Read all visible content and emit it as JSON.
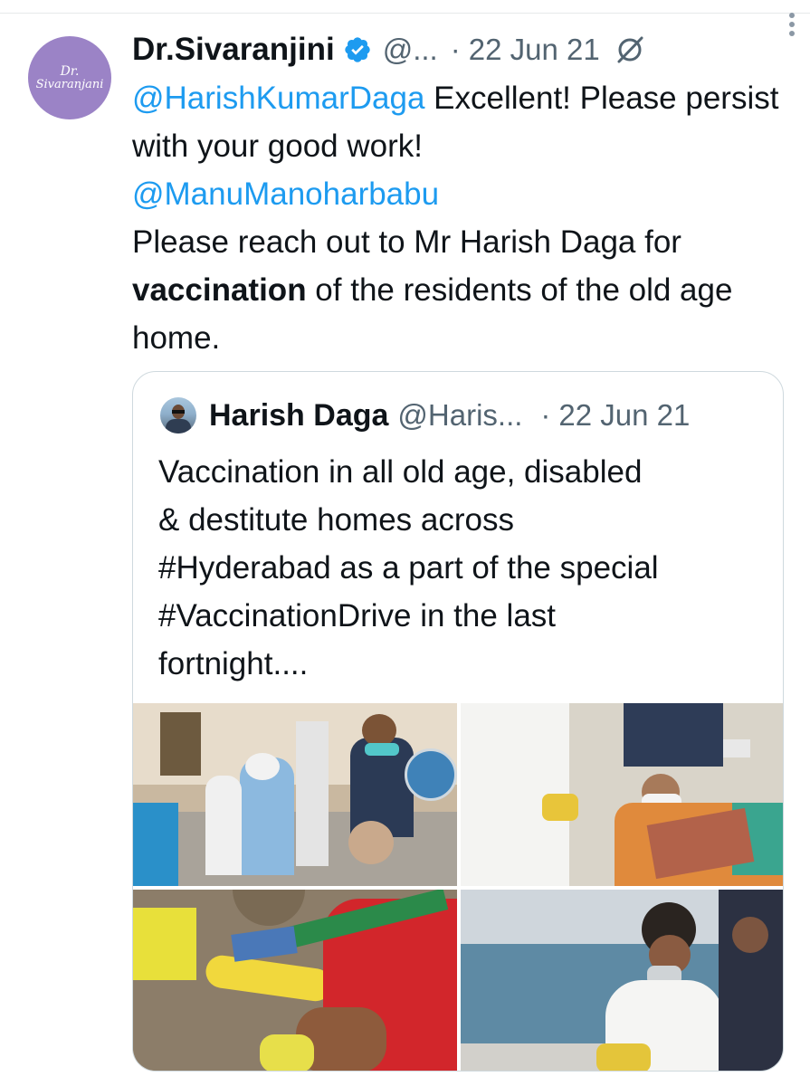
{
  "tweet": {
    "author_name": "Dr.Sivaranjini",
    "avatar_text_line1": "Dr.",
    "avatar_text_line2": "Sivaranjani",
    "handle": "@...",
    "separator": "·",
    "date": "22 Jun 21",
    "text": {
      "mention1": "@HarishKumarDaga",
      "part1": " Excellent! Please persist with your good work!",
      "mention2": "@ManuManoharbabu",
      "part2": "Please reach out to Mr Harish Daga for ",
      "bold": "vaccination",
      "part3": " of the residents of the old age home."
    }
  },
  "quoted_tweet": {
    "author_name": "Harish Daga",
    "handle": "@Haris...",
    "separator": "·",
    "date": "22 Jun 21",
    "lines": [
      "Vaccination in all old age, disabled",
      "& destitute homes across",
      "#Hyderabad as a part of the special",
      "#VaccinationDrive in the last",
      "fortnight...."
    ]
  },
  "colors": {
    "link": "#1d9bf0",
    "secondary_text": "#536471",
    "verified": "#1d9bf0",
    "avatar_bg": "#9b83c6"
  },
  "icons": {
    "verified": "verified-badge-icon",
    "grok": "grok-icon",
    "more": "more-options-icon"
  }
}
